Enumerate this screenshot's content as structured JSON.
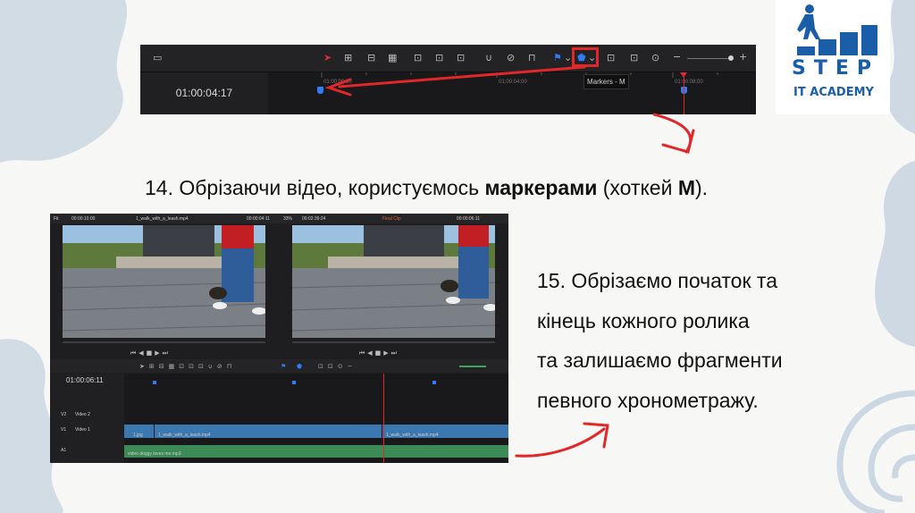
{
  "toolbar": {
    "timecode": "01:00:04:17",
    "tooltip": "Markers - M",
    "ruler_ticks": [
      "01:00:00:00",
      "01:00:04:00",
      "01:00:08:00"
    ]
  },
  "logo": {
    "line1": "STEP",
    "line2": "IT ACADEMY"
  },
  "caption14": {
    "before": "14. Обрізаючи відео, користуємось ",
    "bold1": "маркерами",
    "mid": " (хоткей ",
    "bold2": "М",
    "after": ")."
  },
  "caption15": {
    "lines": [
      "15. Обрізаємо початок та",
      "кінець кожного ролика",
      "та залишаємо фрагменти",
      "певного хронометражу."
    ]
  },
  "editor": {
    "source_zoom": "Fit",
    "source_tc": "00:00:10:00",
    "source_clip": "1_walk_with_a_leash.mp4",
    "source_pos": "00:00:04:11",
    "zoom_pct": "33%",
    "timeline_dur": "00:02:39:24",
    "timeline_name": "Final Clip",
    "timeline_pos": "00:00:06:11",
    "timecode": "01:00:06:11",
    "tracks": {
      "v2": "V2",
      "v2_name": "Video 2",
      "v1": "V1",
      "v1_name": "Video 1",
      "a1": "A1"
    },
    "clips": {
      "clip1": "1.jpg",
      "clip2": "1_walk_with_a_leash.mp4",
      "clip3": "1_walk_with_a_leash.mp4",
      "audio": "video doggy loves me.mp3"
    }
  },
  "colors": {
    "accent_red": "#e0282b",
    "marker_blue": "#2f7cf6",
    "logo_blue": "#1a5ea8",
    "audio_green": "#3c8a55",
    "video_clip_blue": "#3b78b0"
  }
}
